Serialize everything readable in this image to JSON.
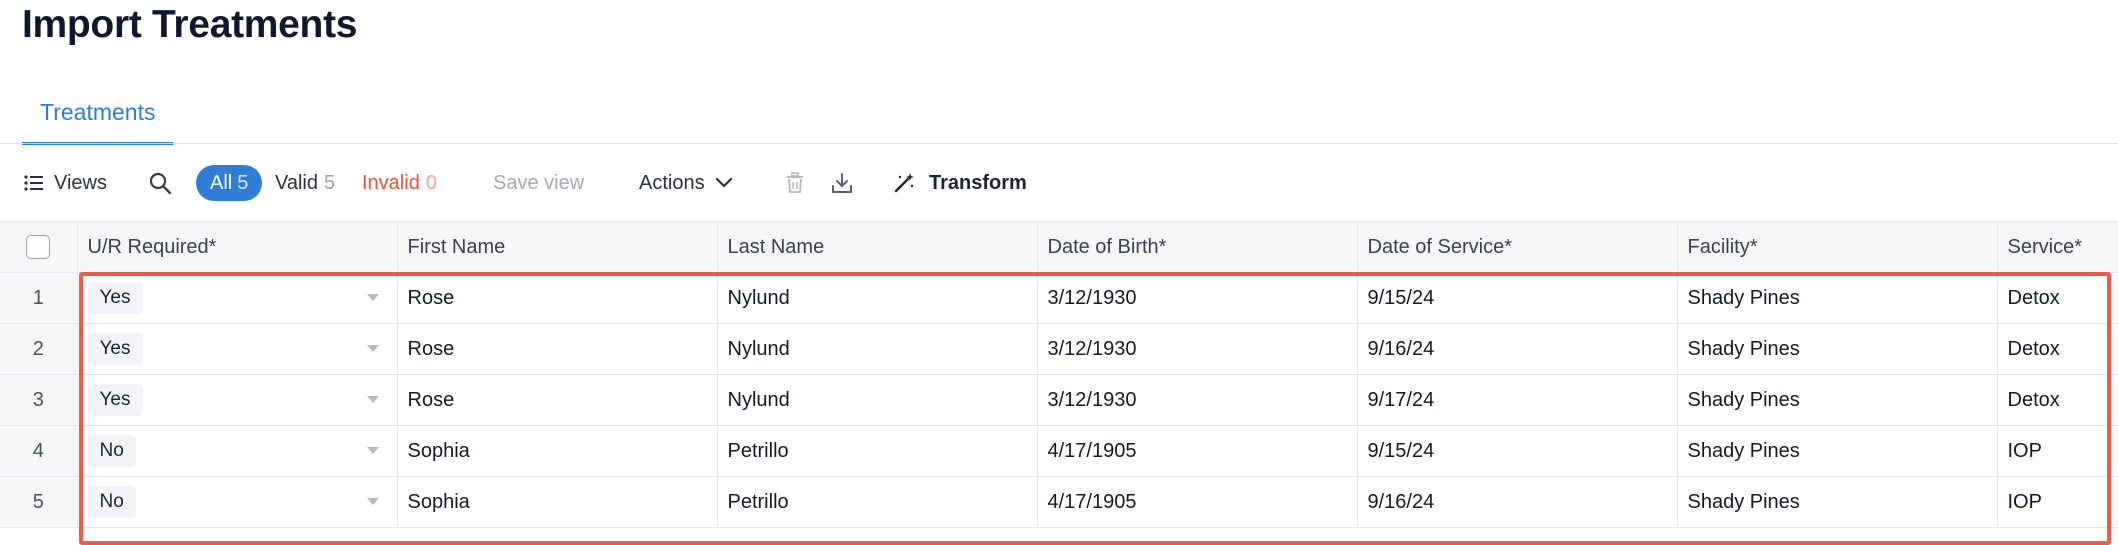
{
  "page": {
    "title": "Import Treatments"
  },
  "tabs": [
    {
      "label": "Treatments"
    }
  ],
  "toolbar": {
    "views_label": "Views",
    "filter_all_label": "All",
    "filter_all_count": "5",
    "filter_valid_label": "Valid",
    "filter_valid_count": "5",
    "filter_invalid_label": "Invalid",
    "filter_invalid_count": "0",
    "save_view_label": "Save view",
    "actions_label": "Actions",
    "transform_label": "Transform"
  },
  "icons": {
    "views": "list-icon",
    "search": "search-icon",
    "actions": "chevron-down-icon",
    "delete": "trash-icon",
    "download": "download-icon",
    "transform": "magic-wand-icon"
  },
  "colors": {
    "accent": "#2f7dd8",
    "invalid": "#e4533f",
    "highlight": "#ec5b4b",
    "title": "#13172e"
  },
  "table": {
    "columns": [
      "U/R Required*",
      "First Name",
      "Last Name",
      "Date of Birth*",
      "Date of Service*",
      "Facility*",
      "Service*"
    ],
    "rows": [
      {
        "num": "1",
        "ur": "Yes",
        "first": "Rose",
        "last": "Nylund",
        "dob": "3/12/1930",
        "dos": "9/15/24",
        "facility": "Shady Pines",
        "service": "Detox"
      },
      {
        "num": "2",
        "ur": "Yes",
        "first": "Rose",
        "last": "Nylund",
        "dob": "3/12/1930",
        "dos": "9/16/24",
        "facility": "Shady Pines",
        "service": "Detox"
      },
      {
        "num": "3",
        "ur": "Yes",
        "first": "Rose",
        "last": "Nylund",
        "dob": "3/12/1930",
        "dos": "9/17/24",
        "facility": "Shady Pines",
        "service": "Detox"
      },
      {
        "num": "4",
        "ur": "No",
        "first": "Sophia",
        "last": "Petrillo",
        "dob": "4/17/1905",
        "dos": "9/15/24",
        "facility": "Shady Pines",
        "service": "IOP"
      },
      {
        "num": "5",
        "ur": "No",
        "first": "Sophia",
        "last": "Petrillo",
        "dob": "4/17/1905",
        "dos": "9/16/24",
        "facility": "Shady Pines",
        "service": "IOP"
      }
    ]
  }
}
